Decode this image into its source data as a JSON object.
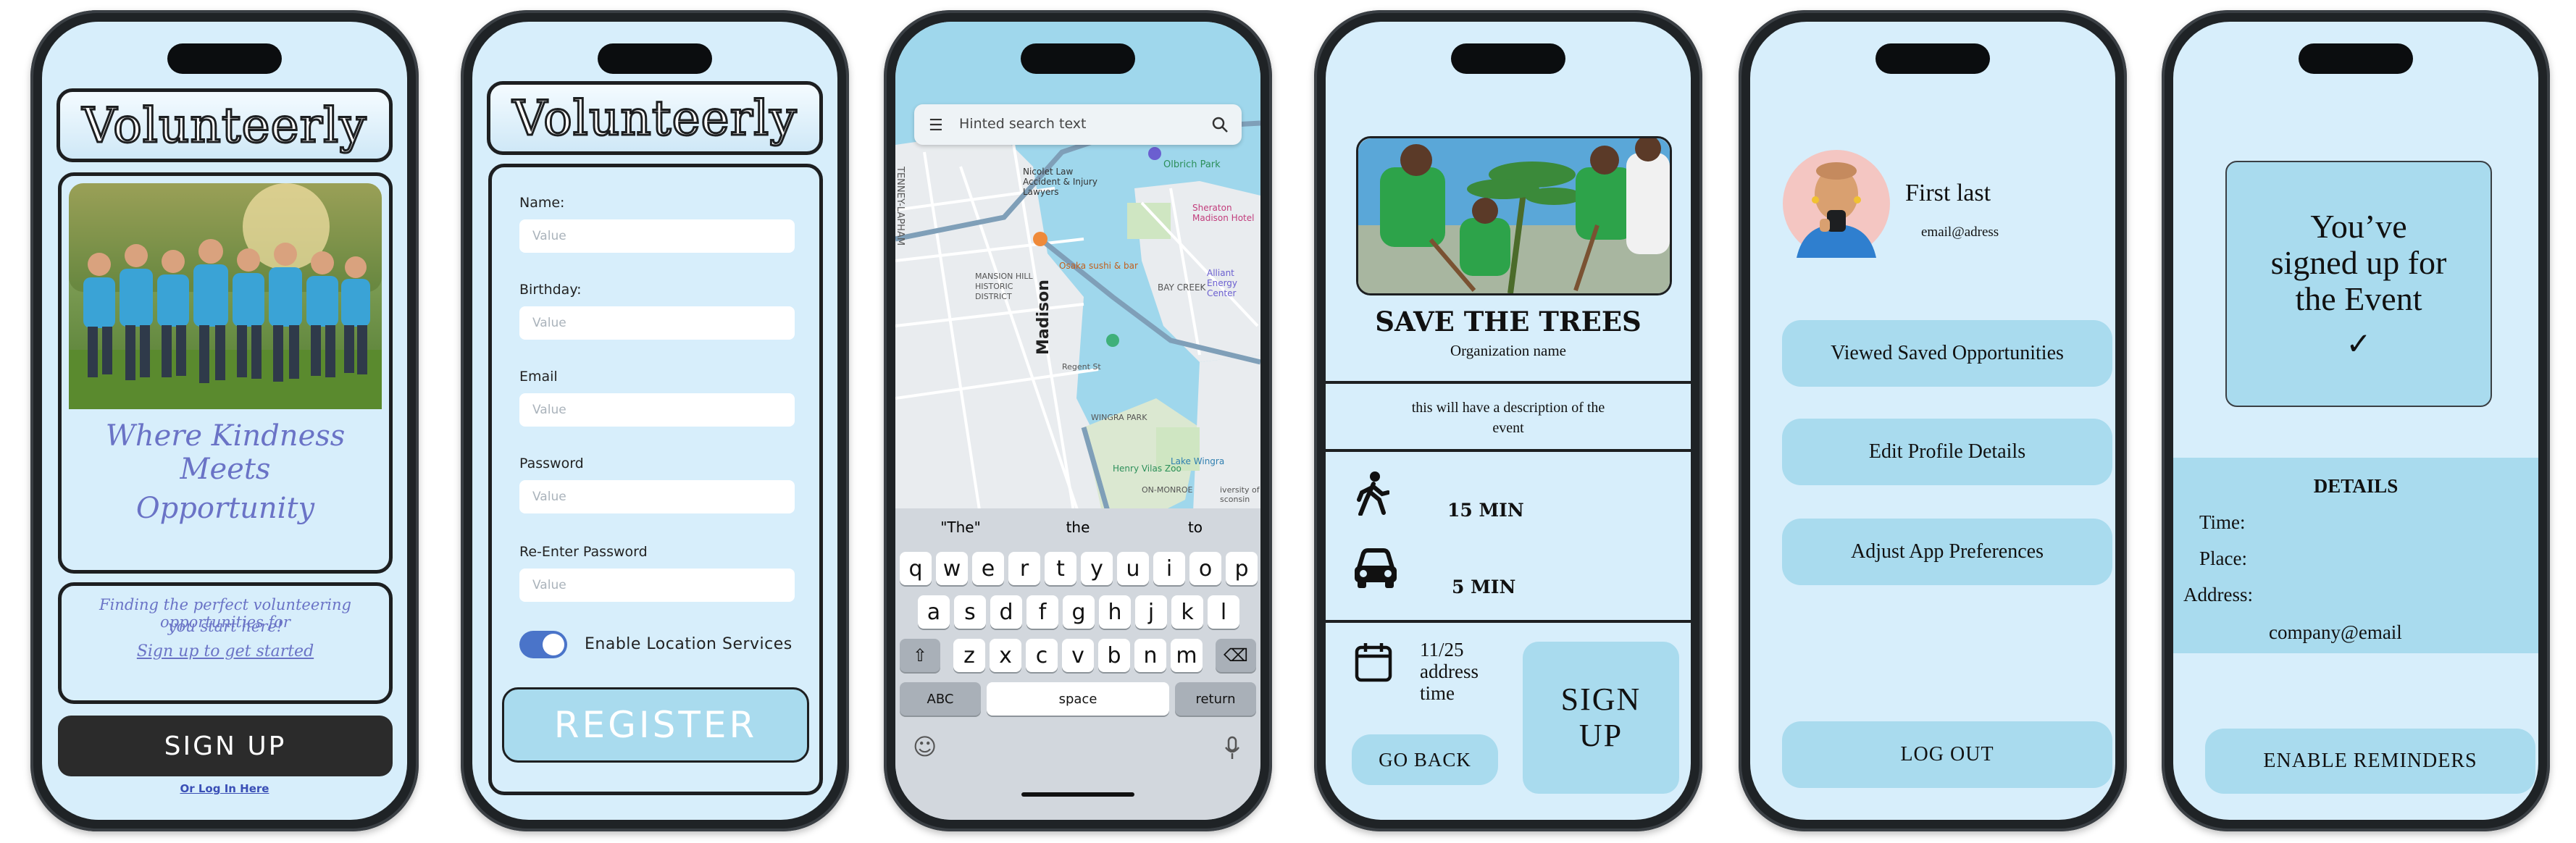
{
  "colors": {
    "screen_bg": "#d7eefb",
    "accent_blue": "#a9dbee",
    "dark_button": "#2b2b2b",
    "handwriting": "#6a73c6",
    "toggle": "#4a74c9"
  },
  "welcome": {
    "app_name": "Volunteerly",
    "tagline_line1": "Where Kindness Meets",
    "tagline_line2": "Opportunity",
    "info_line1": "Finding the perfect volunteering opportunities for",
    "info_line2": "you start here!",
    "info_link": "Sign up to get started",
    "signup_button": "SIGN UP",
    "login_link": "Or Log In Here"
  },
  "register": {
    "app_name": "Volunteerly",
    "fields": [
      {
        "label": "Name:",
        "placeholder": "Value"
      },
      {
        "label": "Birthday:",
        "placeholder": "Value"
      },
      {
        "label": "Email",
        "placeholder": "Value"
      },
      {
        "label": "Password",
        "placeholder": "Value"
      },
      {
        "label": "Re-Enter Password",
        "placeholder": "Value"
      }
    ],
    "location_toggle_label": "Enable Location Services",
    "location_toggle_on": true,
    "register_button": "REGISTER"
  },
  "map": {
    "search_placeholder": "Hinted search text",
    "labels": {
      "tenney": "TENNEY-LAPHAM",
      "mansion": "MANSION HILL HISTORIC DISTRICT",
      "madison": "Madison",
      "nicolet": "Nicolet Law Accident & Injury Lawyers",
      "olbrich": "Olbrich Park",
      "osaka": "Osaka sushi & bar",
      "baycreek": "BAY CREEK",
      "sheraton": "Sheraton Madison Hotel",
      "alliant": "Alliant Energy Center",
      "wingra": "WINGRA PARK",
      "henry": "Henry Vilas Zoo",
      "monroe": "ON-MONROE",
      "lakewingra": "Lake Wingra",
      "regent": "Regent St",
      "university": "iversity of sconsin"
    },
    "suggestions": [
      "\"The\"",
      "the",
      "to"
    ],
    "keys_row1": [
      "q",
      "w",
      "e",
      "r",
      "t",
      "y",
      "u",
      "i",
      "o",
      "p"
    ],
    "keys_row2": [
      "a",
      "s",
      "d",
      "f",
      "g",
      "h",
      "j",
      "k",
      "l"
    ],
    "keys_row3": [
      "z",
      "x",
      "c",
      "v",
      "b",
      "n",
      "m"
    ],
    "key_abc": "ABC",
    "key_space": "space",
    "key_return": "return"
  },
  "event": {
    "title": "SAVE THE TREES",
    "org": "Organization name",
    "description_line1": "this will have a description of the",
    "description_line2": "event",
    "walk_time": "15 MIN",
    "drive_time": "5 MIN",
    "date": "11/25",
    "address": "address",
    "time": "time",
    "signup_button_line1": "SIGN",
    "signup_button_line2": "UP",
    "back_button": "GO BACK"
  },
  "profile": {
    "name": "First last",
    "email": "email@adress",
    "buttons": [
      "Viewed Saved Opportunities",
      "Edit Profile Details",
      "Adjust App Preferences"
    ],
    "logout_button": "LOG OUT"
  },
  "confirm": {
    "message_line1": "You’ve",
    "message_line2": "signed up for",
    "message_line3": "the Event",
    "details_title": "DETAILS",
    "time_label": "Time:",
    "place_label": "Place:",
    "address_label": "Address:",
    "contact": "company@email",
    "reminder_button": "ENABLE REMINDERS"
  }
}
